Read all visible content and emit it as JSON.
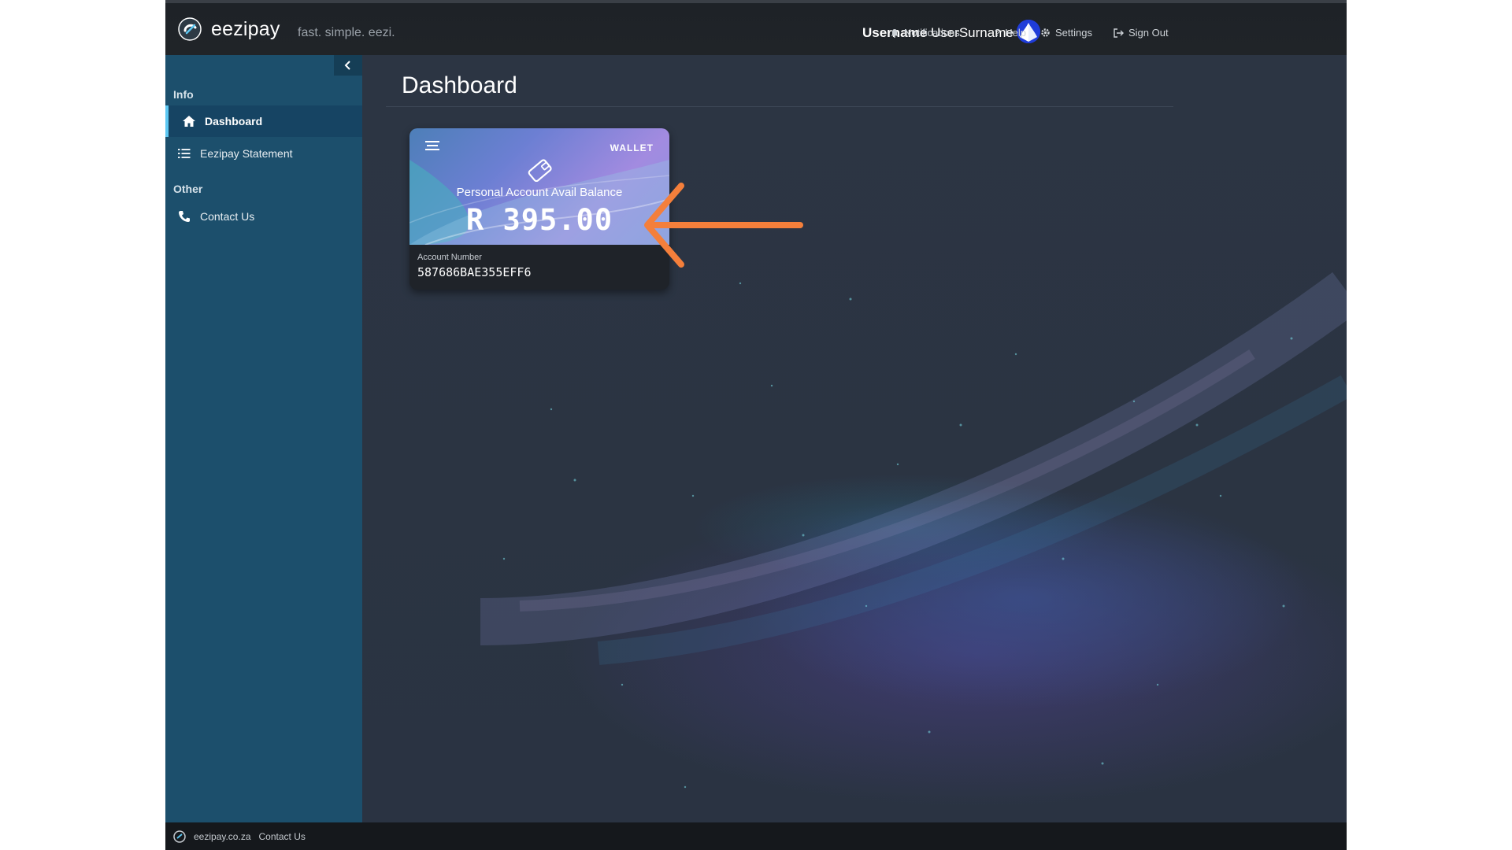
{
  "brand": {
    "name": "eezipay",
    "tagline": "fast. simple. eezi."
  },
  "header": {
    "username_bold": "Username",
    "username_rest": "UserSurname",
    "notifications_label": "Notifications",
    "help_label": "Help",
    "settings_label": "Settings",
    "signout_label": "Sign Out"
  },
  "sidebar": {
    "sections": [
      {
        "label": "Info",
        "items": [
          {
            "label": "Dashboard",
            "icon": "home-icon",
            "active": true
          },
          {
            "label": "Eezipay Statement",
            "icon": "list-icon",
            "active": false
          }
        ]
      },
      {
        "label": "Other",
        "items": [
          {
            "label": "Contact Us",
            "icon": "phone-icon",
            "active": false
          }
        ]
      }
    ]
  },
  "main": {
    "title": "Dashboard",
    "wallet": {
      "tag": "WALLET",
      "label": "Personal Account Avail Balance",
      "balance": "R 395.00",
      "account_label": "Account Number",
      "account_number": "587686BAE355EFF6"
    }
  },
  "footer": {
    "site": "eezipay.co.za",
    "contact": "Contact Us"
  },
  "colors": {
    "header_bg": "#1e2227",
    "sidebar_bg": "#1c4f6c",
    "sidebar_active_bg": "#164463",
    "active_accent": "#5cc7f2",
    "main_bg": "#2a3342",
    "arrow": "#f47f3b",
    "footer_bg": "#15181c"
  }
}
